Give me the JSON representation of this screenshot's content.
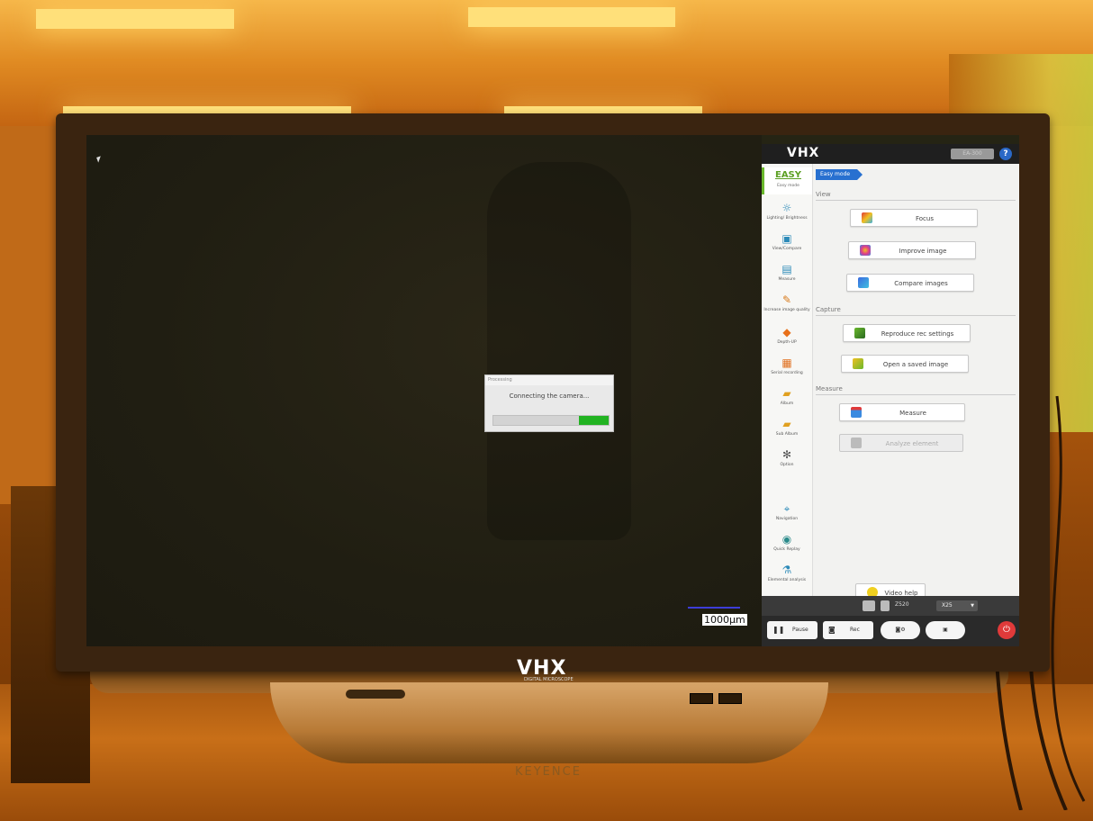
{
  "viewport": {
    "scale_label": "1000μm"
  },
  "dialog": {
    "title": "Processing",
    "message": "Connecting the camera..."
  },
  "panel": {
    "logo": "VHX",
    "model_badge": "EA-300",
    "help_label": "?",
    "mode": {
      "title": "EASY",
      "subtitle": "Easy mode"
    },
    "breadcrumb": "Easy mode",
    "sidebar": [
      {
        "label": "Lighting/ Brightness",
        "icon": "bulb-icon"
      },
      {
        "label": "View/Compare",
        "icon": "compare-icon"
      },
      {
        "label": "Measure",
        "icon": "ruler-icon"
      },
      {
        "label": "Increase image quality",
        "icon": "wand-icon"
      },
      {
        "label": "Depth-UP",
        "icon": "depth-icon"
      },
      {
        "label": "Serial recording",
        "icon": "grid-icon"
      },
      {
        "label": "Album",
        "icon": "folder-icon"
      },
      {
        "label": "Sub Album",
        "icon": "sub-folder-icon"
      },
      {
        "label": "Option",
        "icon": "gear-icon"
      },
      {
        "label": "Navigation",
        "icon": "navigation-icon"
      },
      {
        "label": "Quick Replay",
        "icon": "replay-icon"
      },
      {
        "label": "Elemental analysis",
        "icon": "flask-icon"
      }
    ],
    "sections": {
      "view": "View",
      "capture": "Capture",
      "measure": "Measure"
    },
    "buttons": {
      "focus": "Focus",
      "improve_image": "Improve image",
      "compare_images": "Compare images",
      "reproduce_rec_settings": "Reproduce rec settings",
      "open_saved_image": "Open a saved image",
      "measure": "Measure",
      "analyze_element": "Analyze element",
      "video_help": "Video help"
    },
    "status": {
      "z_value": "Z520",
      "zoom": "X25"
    },
    "controls": {
      "pause": "Pause",
      "rec": "Rec"
    }
  },
  "monitor": {
    "logo": "VHX",
    "sublogo": "DIGITAL MICROSCOPE",
    "brand": "KEYENCE"
  }
}
